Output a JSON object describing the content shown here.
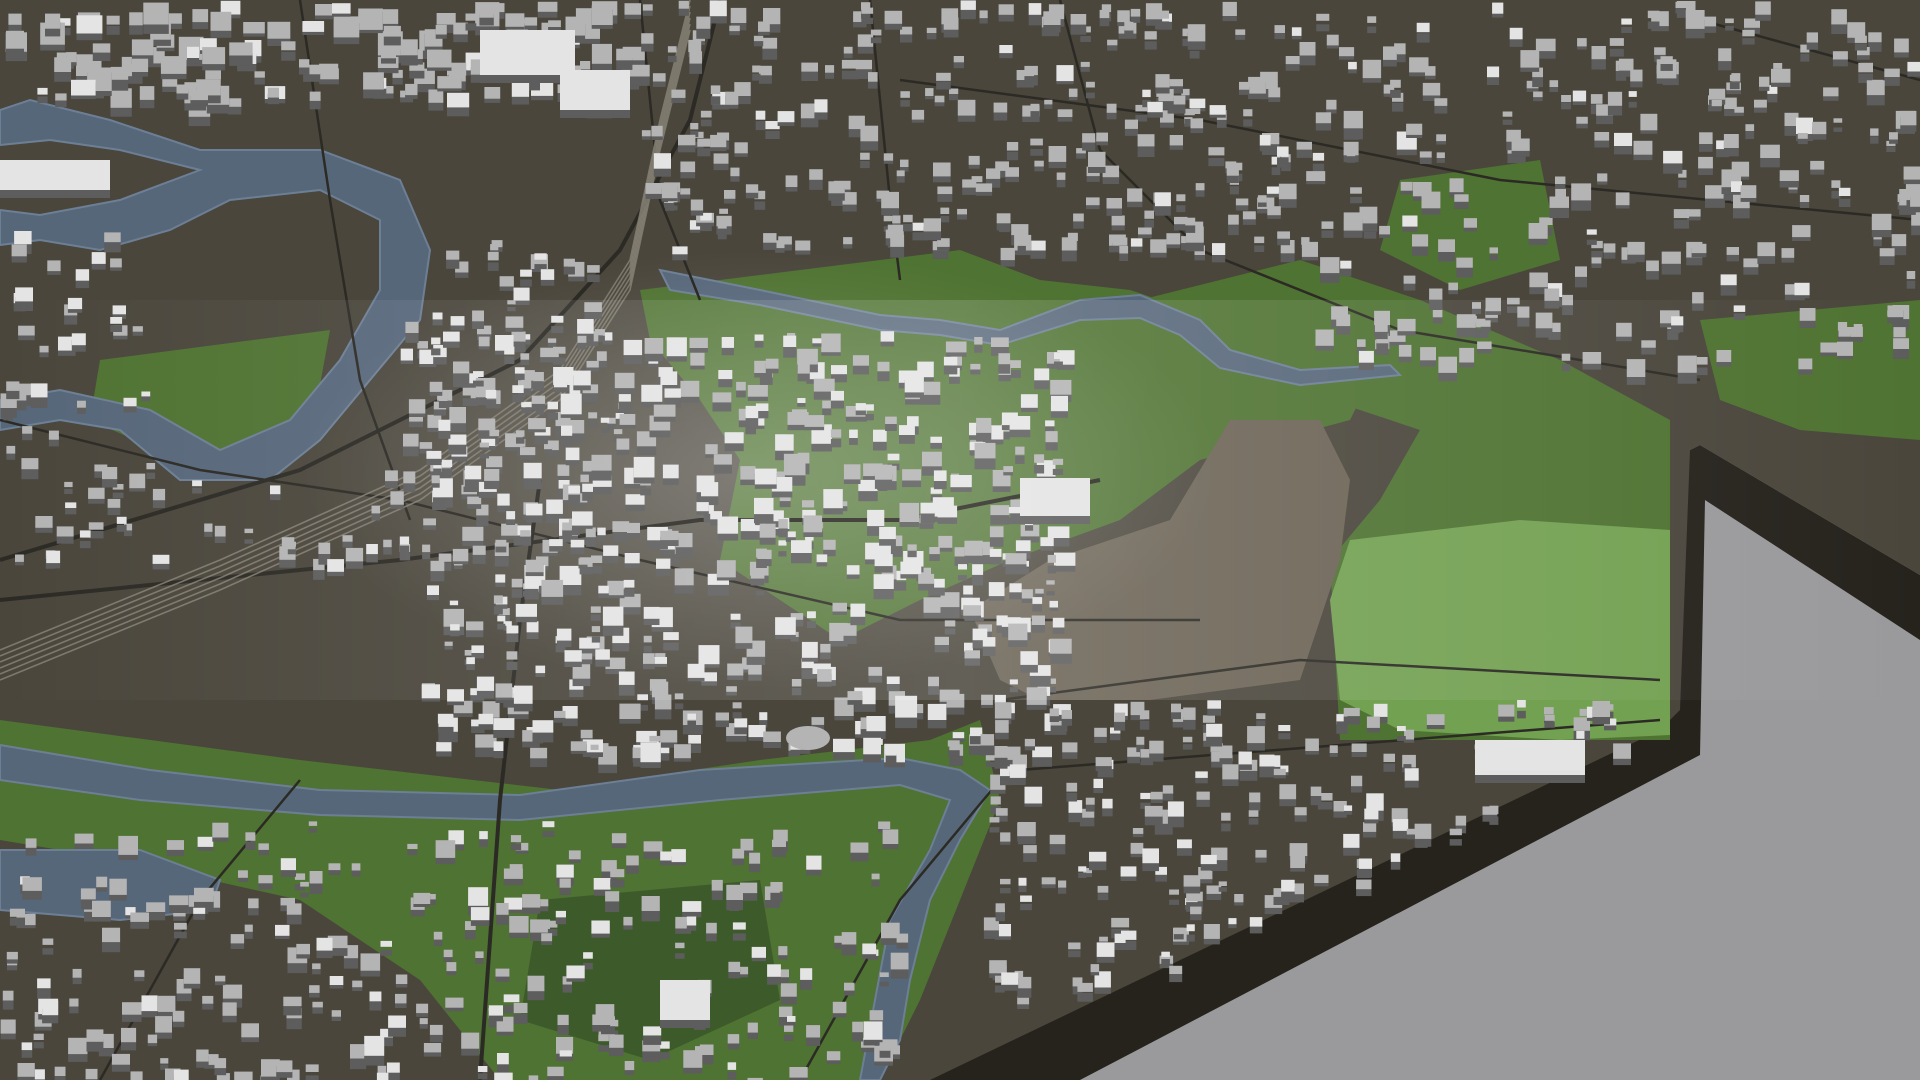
{
  "scene": {
    "kind": "3d-city-model-render",
    "colors": {
      "background": "#9a9a9c",
      "ground": "#4a463c",
      "ground_light": "#6b6355",
      "base_side": "#26231d",
      "base_side_top": "#3a3429",
      "water": "#57677a",
      "water_light": "#6d7f95",
      "park_dark": "#3d5a2a",
      "park": "#4f7332",
      "park_light": "#73a152",
      "building_roof": "#b4b4b4",
      "building_lit": "#e4e4e4",
      "building_side": "#5d5d5d",
      "roads": "#2c2a24",
      "rail": "#8a8578"
    },
    "features": {
      "districts": 7,
      "rivers": 3,
      "parks": 8
    }
  }
}
